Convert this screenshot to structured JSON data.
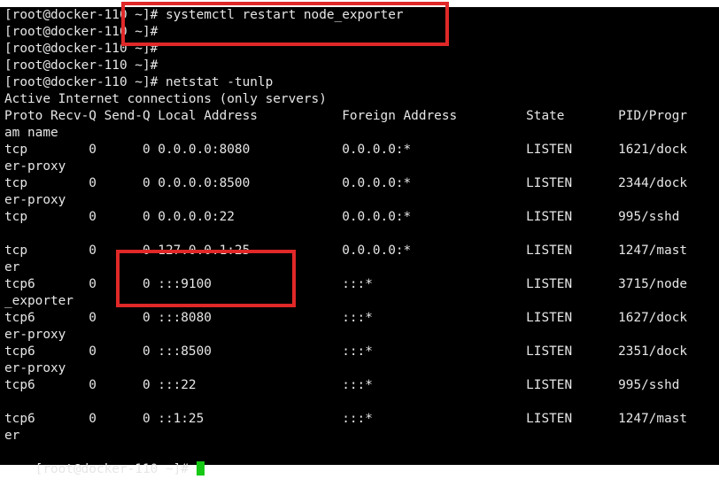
{
  "terminal": {
    "lines": [
      "[root@docker-110 ~]# systemctl restart node_exporter",
      "[root@docker-110 ~]#",
      "[root@docker-110 ~]#",
      "[root@docker-110 ~]#",
      "[root@docker-110 ~]# netstat -tunlp",
      "Active Internet connections (only servers)",
      "Proto Recv-Q Send-Q Local Address           Foreign Address         State       PID/Progr",
      "am name",
      "tcp        0      0 0.0.0.0:8080            0.0.0.0:*               LISTEN      1621/dock",
      "er-proxy",
      "tcp        0      0 0.0.0.0:8500            0.0.0.0:*               LISTEN      2344/dock",
      "er-proxy",
      "tcp        0      0 0.0.0.0:22              0.0.0.0:*               LISTEN      995/sshd",
      "",
      "tcp        0      0 127.0.0.1:25            0.0.0.0:*               LISTEN      1247/mast",
      "er",
      "tcp6       0      0 :::9100                 :::*                    LISTEN      3715/node",
      "_exporter",
      "tcp6       0      0 :::8080                 :::*                    LISTEN      1627/dock",
      "er-proxy",
      "tcp6       0      0 :::8500                 :::*                    LISTEN      2351/dock",
      "er-proxy",
      "tcp6       0      0 :::22                   :::*                    LISTEN      995/sshd",
      "",
      "tcp6       0      0 ::1:25                  :::*                    LISTEN      1247/mast",
      "er"
    ],
    "prompt": "[root@docker-110 ~]# ",
    "cursor_color": "#14c814",
    "highlight_color": "#e02828"
  }
}
